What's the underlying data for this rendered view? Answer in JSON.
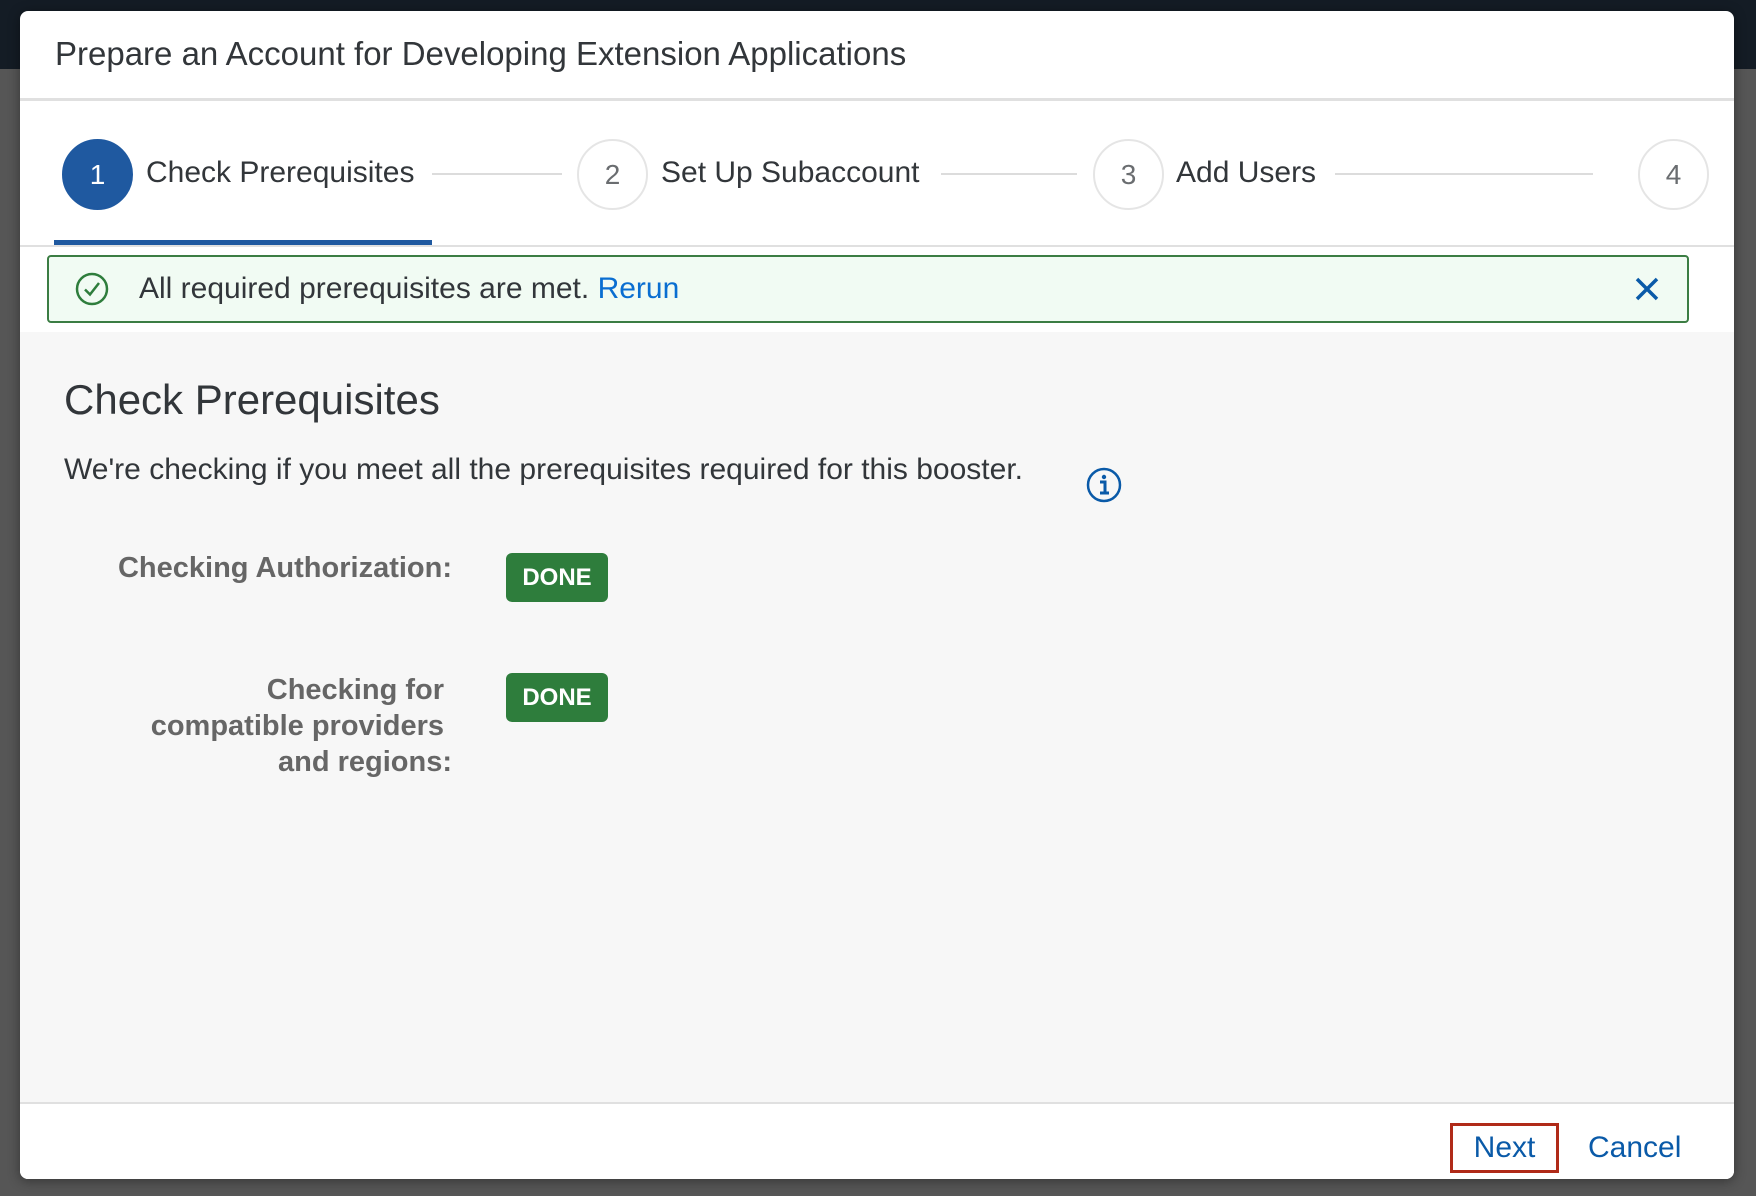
{
  "dialog": {
    "title": "Prepare an Account for Developing Extension Applications"
  },
  "wizard": {
    "steps": [
      {
        "number": "1",
        "label": "Check Prerequisites",
        "active": true
      },
      {
        "number": "2",
        "label": "Set Up Subaccount",
        "active": false
      },
      {
        "number": "3",
        "label": "Add Users",
        "active": false
      },
      {
        "number": "4",
        "label": "",
        "active": false
      }
    ]
  },
  "message_strip": {
    "icon": "success-check-icon",
    "text": "All required prerequisites are met.",
    "link": "Rerun",
    "close_icon": "close-icon"
  },
  "content": {
    "heading": "Check Prerequisites",
    "description": "We're checking if you meet all the prerequisites required for this booster.",
    "info_icon": "info-icon",
    "checks": [
      {
        "label": "Checking Authorization:",
        "status": "DONE"
      },
      {
        "label_lines": [
          "Checking for",
          "compatible providers",
          "and regions:"
        ],
        "status": "DONE"
      }
    ]
  },
  "footer": {
    "next_label": "Next",
    "cancel_label": "Cancel"
  },
  "colors": {
    "accent": "#1f59a0",
    "success": "#2e7d3c",
    "link": "#0a6ed1",
    "highlight_border": "#b02a18"
  }
}
